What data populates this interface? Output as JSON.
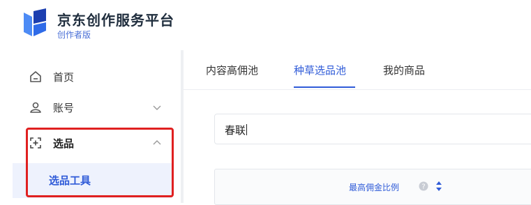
{
  "brand": {
    "title": "京东创作服务平台",
    "subtitle": "创作者版",
    "colors": {
      "primary": "#2f5bd8",
      "logo_dark": "#1c3fb0",
      "logo_light": "#4d8bf5",
      "highlight": "#e02020"
    }
  },
  "sidebar": {
    "items": [
      {
        "label": "首页",
        "icon": "home-icon"
      },
      {
        "label": "账号",
        "icon": "user-icon",
        "chevron": "chevron-down-icon"
      },
      {
        "label": "选品",
        "icon": "select-product-icon",
        "chevron": "chevron-up-icon",
        "expanded": true
      }
    ],
    "subitems": [
      {
        "label": "选品工具",
        "active": true
      }
    ]
  },
  "tabs": [
    {
      "label": "内容高佣池",
      "active": false
    },
    {
      "label": "种草选品池",
      "active": true
    },
    {
      "label": "我的商品",
      "active": false
    }
  ],
  "search": {
    "value": "春联"
  },
  "table": {
    "columns": [
      {
        "label": "最高佣金比例",
        "help_icon": "question-circle-icon",
        "sort_icon": "sort-icon"
      }
    ]
  }
}
